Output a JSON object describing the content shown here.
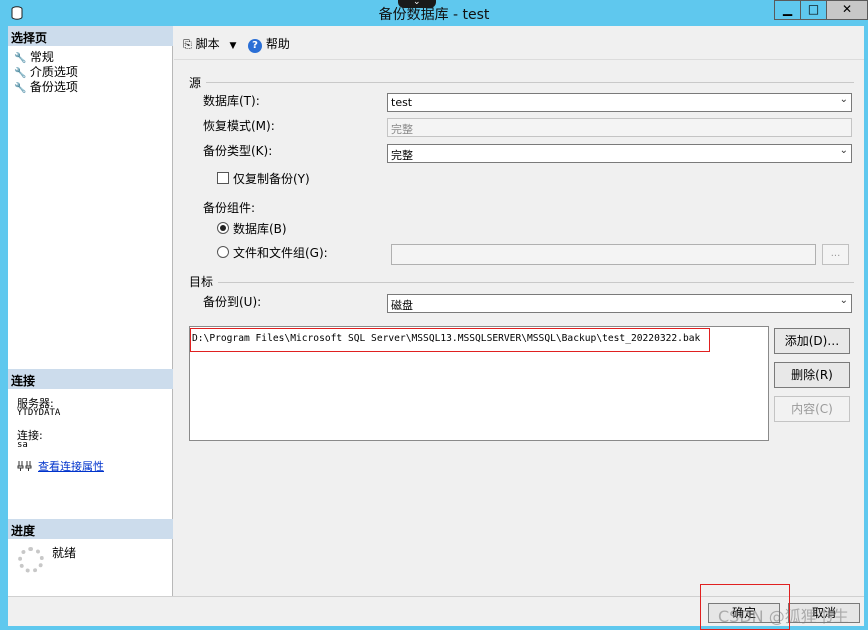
{
  "window": {
    "title": "备份数据库 - test",
    "minimize_glyph": "▁",
    "maximize_glyph": "□",
    "close_glyph": "✕",
    "notch_glyph": "⌄"
  },
  "sidebar": {
    "select_page_header": "选择页",
    "pages": [
      {
        "label": "常规",
        "icon": "wrench-icon"
      },
      {
        "label": "介质选项",
        "icon": "wrench-icon"
      },
      {
        "label": "备份选项",
        "icon": "wrench-icon"
      }
    ],
    "connection_header": "连接",
    "server_label": "服务器:",
    "server_value": "YTDYDATA",
    "connection_label": "连接:",
    "connection_value": "sa",
    "view_connection_link": "查看连接属性",
    "progress_header": "进度",
    "progress_status": "就绪"
  },
  "toolbar": {
    "script_label": "脚本",
    "help_label": "帮助"
  },
  "source": {
    "group_label": "源",
    "database_label": "数据库(T):",
    "database_value": "test",
    "recovery_label": "恢复模式(M):",
    "recovery_value": "完整",
    "backup_type_label": "备份类型(K):",
    "backup_type_value": "完整",
    "copy_only_label": "仅复制备份(Y)",
    "copy_only_checked": false,
    "component_label": "备份组件:",
    "component_database_label": "数据库(B)",
    "component_files_label": "文件和文件组(G):",
    "component_selected": "database",
    "browse_label": "..."
  },
  "destination": {
    "group_label": "目标",
    "backup_to_label": "备份到(U):",
    "backup_to_value": "磁盘",
    "paths": [
      "D:\\Program Files\\Microsoft SQL Server\\MSSQL13.MSSQLSERVER\\MSSQL\\Backup\\test_20220322.bak"
    ],
    "add_label": "添加(D)…",
    "remove_label": "删除(R)",
    "contents_label": "内容(C)"
  },
  "footer": {
    "ok_label": "确定",
    "cancel_label": "取消",
    "watermark": "CSDN @狐狸书生"
  },
  "colors": {
    "titlebar": "#5fc8ee",
    "section_header": "#ccdcec",
    "highlight": "#e02020",
    "link": "#0033cc"
  }
}
